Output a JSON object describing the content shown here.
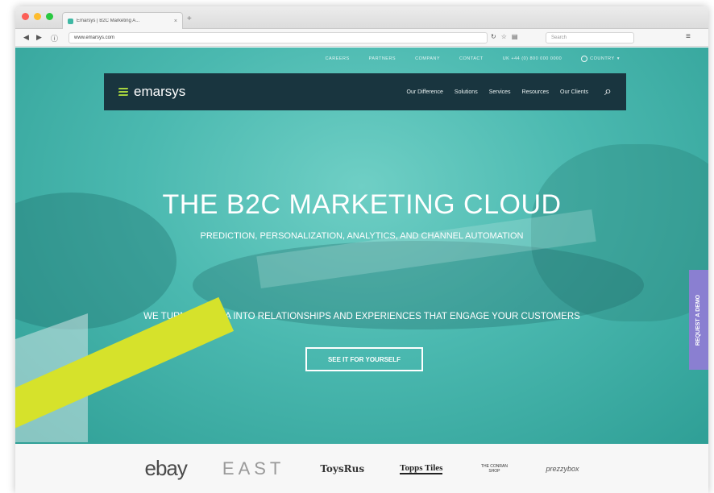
{
  "browser": {
    "tab_title": "Emarsys | B2C Marketing A...",
    "tab_close": "×",
    "new_tab": "+",
    "url": "www.emarsys.com",
    "search_placeholder": "Search",
    "back_icon": "back-arrow",
    "forward_icon": "forward-arrow"
  },
  "utility_nav": {
    "items": [
      "CAREERS",
      "PARTNERS",
      "COMPANY",
      "CONTACT",
      "UK +44 (0) 800 000 0000"
    ],
    "country": "COUNTRY"
  },
  "site_nav": {
    "logo": "emarsys",
    "links": [
      "Our Difference",
      "Solutions",
      "Services",
      "Resources",
      "Our Clients"
    ],
    "search_icon": "search-icon"
  },
  "hero": {
    "headline": "THE B2C MARKETING CLOUD",
    "subheadline": "PREDICTION, PERSONALIZATION, ANALYTICS, AND CHANNEL AUTOMATION",
    "tagline": "WE TURN BIG DATA INTO RELATIONSHIPS AND EXPERIENCES THAT ENGAGE YOUR CUSTOMERS",
    "cta": "SEE IT FOR YOURSELF",
    "side_tab": "REQUEST A DEMO"
  },
  "clients": {
    "logos": [
      "ebay",
      "EAST",
      "ToysRus",
      "Topps Tiles",
      "THE CONRAN SHOP",
      "prezzybox"
    ]
  },
  "colors": {
    "nav_bg": "#19353f",
    "hero_teal": "#4bb9b0",
    "accent_lime": "#d6e22b",
    "demo_tab": "#8a7fd1"
  }
}
